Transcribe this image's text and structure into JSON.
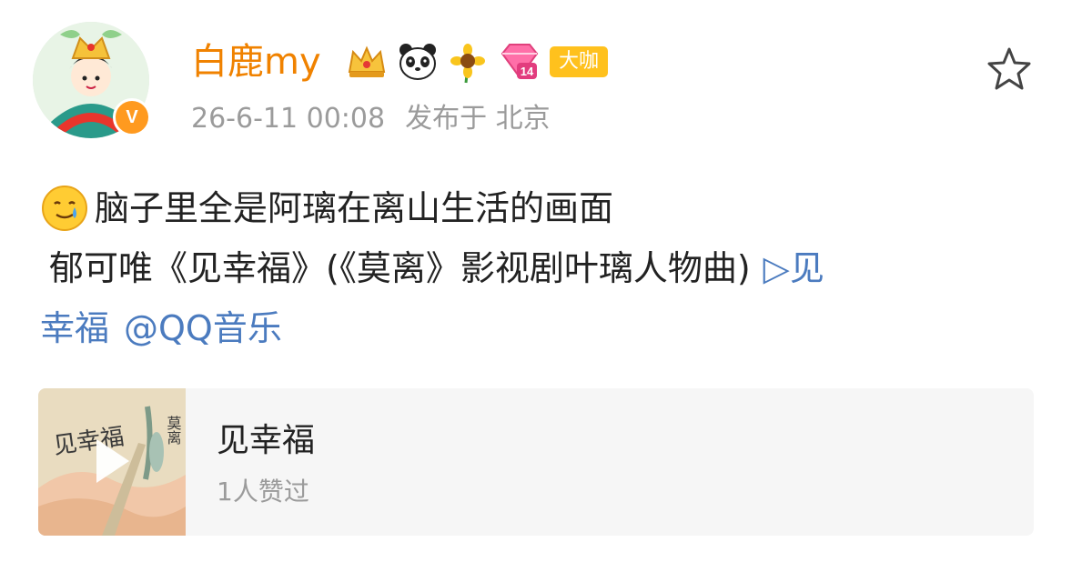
{
  "post": {
    "author": {
      "name": "白鹿my",
      "avatar_icon": "avatar-illustration",
      "verified_badge": "V",
      "badges": [
        "crown-icon",
        "panda-icon",
        "sunflower-icon",
        "diamond-level-icon"
      ],
      "diamond_level": "14",
      "tag": "大咖"
    },
    "timestamp": "26-6-11 00:08",
    "location_label": "发布于 北京",
    "favorite_icon": "star-icon",
    "text": {
      "emoji": "teary-smile-emoji",
      "line1": "脑子里全是阿璃在离山生活的画面",
      "line2_prefix": "郁可唯《见幸福》(《莫离》影视剧叶璃人物曲)",
      "line2_link": "▷见",
      "line3_link_a": "幸福",
      "line3_link_b": "@QQ音乐"
    },
    "music_card": {
      "cover_text_a": "见幸福",
      "cover_text_b": "莫离",
      "title": "见幸福",
      "likes": "1人赞过",
      "play_icon": "play-icon"
    }
  },
  "colors": {
    "username": "#f08200",
    "link": "#4b7bbf",
    "meta": "#9b9b9b",
    "tag_bg": "#ffc11d",
    "card_bg": "#f6f6f6"
  }
}
